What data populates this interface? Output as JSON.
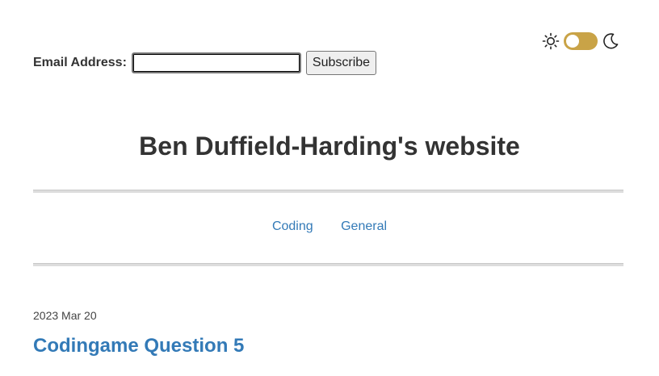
{
  "subscribe": {
    "label": "Email Address:",
    "input_value": "",
    "button_label": "Subscribe"
  },
  "theme": {
    "light_icon": "sun-icon",
    "dark_icon": "moon-icon",
    "toggle_state": "light",
    "toggle_color": "#c9a347"
  },
  "site": {
    "title": "Ben Duffield-Harding's website"
  },
  "nav": {
    "items": [
      {
        "label": "Coding"
      },
      {
        "label": "General"
      }
    ]
  },
  "post": {
    "date": "2023 Mar 20",
    "title": "Codingame Question 5"
  },
  "colors": {
    "link": "#337ab7",
    "text": "#333333",
    "rule": "#dddddd"
  }
}
